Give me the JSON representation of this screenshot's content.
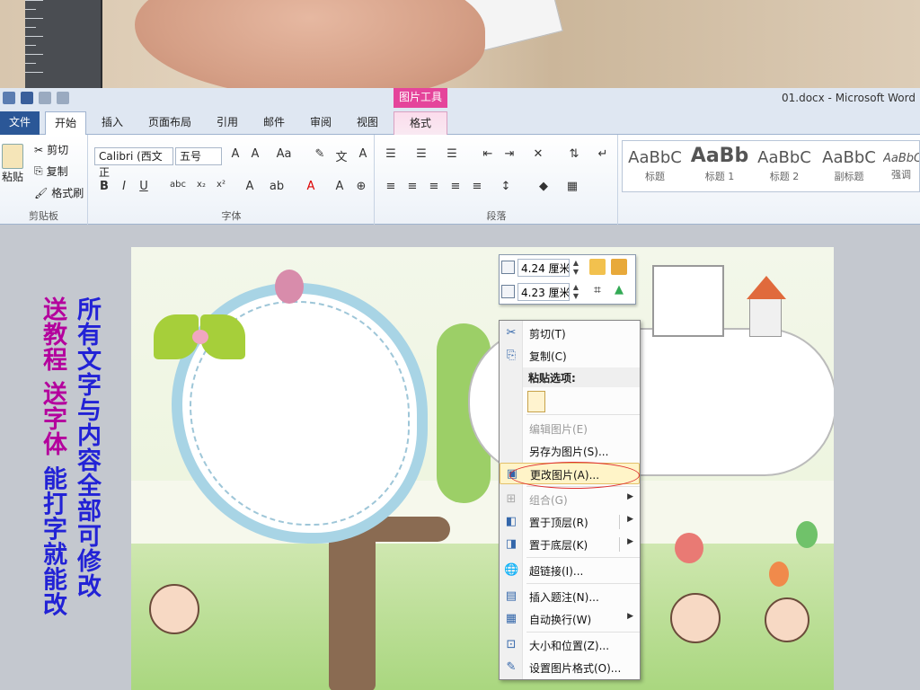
{
  "window": {
    "title": "01.docx  -  Microsoft Word",
    "picture_tools": "图片工具"
  },
  "tabs": [
    {
      "label": "文件"
    },
    {
      "label": "开始"
    },
    {
      "label": "插入"
    },
    {
      "label": "页面布局"
    },
    {
      "label": "引用"
    },
    {
      "label": "邮件"
    },
    {
      "label": "审阅"
    },
    {
      "label": "视图"
    },
    {
      "label": "格式"
    }
  ],
  "clipboard": {
    "paste": "粘贴",
    "cut": "剪切",
    "copy": "复制",
    "format_painter": "格式刷",
    "group": "剪贴板"
  },
  "font": {
    "name": "Calibri (西文正",
    "size": "五号",
    "group": "字体"
  },
  "paragraph": {
    "group": "段落"
  },
  "styles": [
    {
      "sample": "AaBbC",
      "name": "标题"
    },
    {
      "sample": "AaBb",
      "name": "标题 1"
    },
    {
      "sample": "AaBbC",
      "name": "标题 2"
    },
    {
      "sample": "AaBbC",
      "name": "副标题"
    },
    {
      "sample": "AaBbC",
      "name": "强调"
    }
  ],
  "size_box": {
    "height": "4.24 厘米",
    "width": "4.23 厘米"
  },
  "context_menu": {
    "items": [
      {
        "label": "剪切(T)",
        "icon": "scissors-icon",
        "disabled": false
      },
      {
        "label": "复制(C)",
        "icon": "copy-icon",
        "disabled": false
      },
      {
        "header": "粘贴选项:"
      },
      {
        "label": "编辑图片(E)",
        "disabled": true
      },
      {
        "label": "另存为图片(S)...",
        "disabled": false
      },
      {
        "label": "更改图片(A)...",
        "icon": "change-picture-icon",
        "highlighted": true
      },
      {
        "label": "组合(G)",
        "icon": "group-icon",
        "disabled": true,
        "submenu": true
      },
      {
        "label": "置于顶层(R)",
        "icon": "bring-front-icon",
        "submenu": true
      },
      {
        "label": "置于底层(K)",
        "icon": "send-back-icon",
        "submenu": true
      },
      {
        "label": "超链接(I)...",
        "icon": "hyperlink-icon"
      },
      {
        "label": "插入题注(N)...",
        "icon": "caption-icon"
      },
      {
        "label": "自动换行(W)",
        "icon": "wrap-icon",
        "submenu": true
      },
      {
        "label": "大小和位置(Z)...",
        "icon": "size-position-icon"
      },
      {
        "label": "设置图片格式(O)...",
        "icon": "format-picture-icon"
      }
    ]
  },
  "promo": {
    "col1": "送教程 送字体 能打字就能改",
    "col1_a": "送教程",
    "col1_b": "送字体",
    "col1_c": "能打字就能改",
    "col2": "所有文字与内容全部可修改"
  },
  "colors": {
    "accent": "#2b5797",
    "picture_tools": "#e5449b",
    "highlight": "#e03030"
  }
}
